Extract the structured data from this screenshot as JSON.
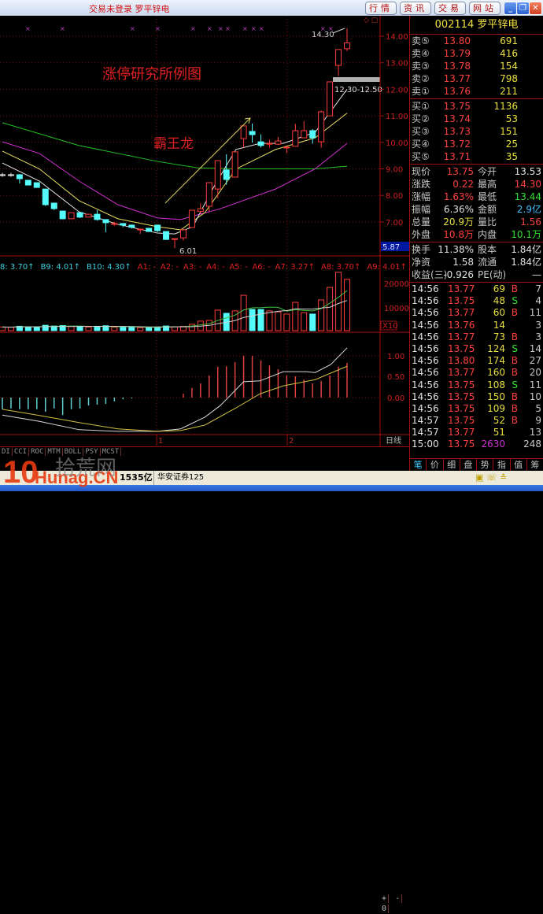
{
  "window": {
    "title": "交易未登录 罗平锌电",
    "nav_buttons": [
      "行情",
      "资讯",
      "交易",
      "网站"
    ],
    "window_buttons": [
      "minimize",
      "restore",
      "close"
    ]
  },
  "chart": {
    "annotation_title": "涨停研究所例图",
    "annotation_pattern": "霸王龙",
    "high_label": "14.30",
    "low_label": "6.01",
    "zone_label": "12.30-12.50",
    "zone": [
      12.3,
      12.5
    ],
    "price_ticks": [
      "14.00",
      "13.00",
      "12.00",
      "11.00",
      "10.00",
      "9.00",
      "8.00",
      "7.00"
    ],
    "cursor_price": "5.87",
    "colors": {
      "up": "#ff3c3c",
      "down": "#54fcfc",
      "ma5": "#e8e8e8",
      "ma10": "#e8e060",
      "ma30": "#d030d0",
      "ma60": "#20c020"
    },
    "kline": [
      [
        8.78,
        8.78,
        8.85,
        8.7
      ],
      [
        8.78,
        8.78,
        8.85,
        8.7
      ],
      [
        8.78,
        8.63,
        8.8,
        8.45
      ],
      [
        8.57,
        8.39,
        8.57,
        8.39
      ],
      [
        8.48,
        8.3,
        8.48,
        8.3
      ],
      [
        8.24,
        7.65,
        8.24,
        7.6
      ],
      [
        7.71,
        7.5,
        7.71,
        7.45
      ],
      [
        7.41,
        7.12,
        7.41,
        7.1
      ],
      [
        7.12,
        7.35,
        7.35,
        7.12
      ],
      [
        7.35,
        7.18,
        7.35,
        7.15
      ],
      [
        7.18,
        7.29,
        7.29,
        7.18
      ],
      [
        7.29,
        7.09,
        7.45,
        7.05
      ],
      [
        7.09,
        6.97,
        7.09,
        6.61
      ],
      [
        6.94,
        6.94,
        7.0,
        6.85
      ],
      [
        6.94,
        6.88,
        6.94,
        6.8
      ],
      [
        6.88,
        6.8,
        6.9,
        6.75
      ],
      [
        6.73,
        6.73,
        6.73,
        6.55
      ],
      [
        6.76,
        6.64,
        6.76,
        6.62
      ],
      [
        6.88,
        6.67,
        6.9,
        6.62
      ],
      [
        6.64,
        6.34,
        6.64,
        6.32
      ],
      [
        6.37,
        6.37,
        6.37,
        6.01
      ],
      [
        6.4,
        6.7,
        6.75,
        6.3
      ],
      [
        6.79,
        7.44,
        7.44,
        6.79
      ],
      [
        7.4,
        7.5,
        7.7,
        7.3
      ],
      [
        7.59,
        8.48,
        8.48,
        7.4
      ],
      [
        8.24,
        9.31,
        9.31,
        7.9
      ],
      [
        8.96,
        8.6,
        9.55,
        8.4
      ],
      [
        8.69,
        9.64,
        9.64,
        8.69
      ],
      [
        10.14,
        10.62,
        10.62,
        9.8
      ],
      [
        10.41,
        10.29,
        10.71,
        9.99
      ],
      [
        10.02,
        9.88,
        10.3,
        9.8
      ],
      [
        9.96,
        9.96,
        10.1,
        9.8
      ],
      [
        9.93,
        10.05,
        10.2,
        9.9
      ],
      [
        9.82,
        9.82,
        9.82,
        9.6
      ],
      [
        9.85,
        10.44,
        10.7,
        9.85
      ],
      [
        10.17,
        10.44,
        10.8,
        10.17
      ],
      [
        10.44,
        10.17,
        10.5,
        9.95
      ],
      [
        10.02,
        11.15,
        11.2,
        9.8
      ],
      [
        11.0,
        12.28,
        12.28,
        11.0
      ],
      [
        12.9,
        13.5,
        13.5,
        12.5
      ],
      [
        13.53,
        13.75,
        14.3,
        13.44
      ]
    ],
    "ma_lines": {
      "ma60": [
        [
          0,
          10.74
        ],
        [
          8.9,
          9.88
        ],
        [
          18,
          9.28
        ],
        [
          22.6,
          9.04
        ],
        [
          27.1,
          9.0
        ],
        [
          36.3,
          9.0
        ],
        [
          40,
          9.1
        ]
      ],
      "ma30": [
        [
          0,
          10.02
        ],
        [
          4.3,
          9.58
        ],
        [
          8.9,
          8.54
        ],
        [
          13.4,
          7.65
        ],
        [
          18,
          7.15
        ],
        [
          20.7,
          7.09
        ],
        [
          25.3,
          7.5
        ],
        [
          31.7,
          8.24
        ],
        [
          36.3,
          9.0
        ],
        [
          40,
          9.96
        ]
      ],
      "ma10": [
        [
          0,
          9.67
        ],
        [
          4.3,
          9.0
        ],
        [
          8.9,
          7.8
        ],
        [
          13.4,
          7.12
        ],
        [
          18,
          6.82
        ],
        [
          20.7,
          6.7
        ],
        [
          23.5,
          7.35
        ],
        [
          27.1,
          8.99
        ],
        [
          31.7,
          9.73
        ],
        [
          36.3,
          10.17
        ],
        [
          40,
          11.1
        ]
      ],
      "ma5": [
        [
          0,
          9.22
        ],
        [
          4.3,
          8.54
        ],
        [
          8.9,
          7.38
        ],
        [
          13.4,
          6.91
        ],
        [
          18,
          6.58
        ],
        [
          20,
          6.55
        ],
        [
          22.1,
          6.82
        ],
        [
          24.4,
          8.24
        ],
        [
          27.1,
          9.73
        ],
        [
          29.9,
          9.96
        ],
        [
          32.6,
          9.96
        ],
        [
          36.3,
          10.38
        ],
        [
          40,
          12.0
        ]
      ]
    },
    "volume_legend_cyan": [
      "8: 3.70↑",
      "B9: 4.01↑",
      "B10: 4.30↑"
    ],
    "volume_legend_red": [
      "A1: -",
      "A2: -",
      "A3: -",
      "A4: -",
      "A5: -",
      "A6: -",
      "A7: 3.27↑",
      "A8: 3.70↑",
      "A9: 4.01↑",
      "A"
    ],
    "volume_ticks": [
      "20000",
      "10000"
    ],
    "volume_unit": "X10",
    "volume": [
      1500,
      1400,
      1800,
      1600,
      1500,
      2200,
      1900,
      2100,
      1700,
      1600,
      1500,
      1800,
      2000,
      1400,
      1300,
      1500,
      1200,
      1400,
      1500,
      1900,
      1600,
      1800,
      2600,
      3900,
      4200,
      8400,
      7100,
      8100,
      14500,
      8700,
      8700,
      8100,
      7700,
      6800,
      11600,
      7400,
      6800,
      12600,
      17700,
      23900,
      21000
    ],
    "macd_ticks": [
      "1.00",
      "0.50",
      "0.00"
    ],
    "macd": [
      -0.28,
      -0.26,
      -0.28,
      -0.28,
      -0.28,
      -0.34,
      -0.26,
      -0.42,
      -0.28,
      -0.26,
      -0.19,
      -0.17,
      -0.15,
      -0.09,
      -0.04,
      -0.02,
      0,
      0,
      0,
      0,
      0,
      0.09,
      0.23,
      0.34,
      0.53,
      0.74,
      0.75,
      0.85,
      1.0,
      1.0,
      0.89,
      0.77,
      0.68,
      0.53,
      0.51,
      0.43,
      0.34,
      0.4,
      0.53,
      0.74,
      0.83
    ],
    "dif": [
      [
        0,
        -0.42
      ],
      [
        4.3,
        -0.57
      ],
      [
        8.9,
        -0.77
      ],
      [
        13.4,
        -0.81
      ],
      [
        18,
        -0.81
      ],
      [
        20.7,
        -0.75
      ],
      [
        23.5,
        -0.47
      ],
      [
        25.3,
        -0.19
      ],
      [
        28,
        0.38
      ],
      [
        29.9,
        0.4
      ],
      [
        32.6,
        0.62
      ],
      [
        35.3,
        0.62
      ],
      [
        36.3,
        0.6
      ],
      [
        38.1,
        0.79
      ],
      [
        40,
        1.19
      ]
    ],
    "dea": [
      [
        0,
        -0.28
      ],
      [
        4.3,
        -0.43
      ],
      [
        8.9,
        -0.6
      ],
      [
        13.4,
        -0.75
      ],
      [
        18,
        -0.81
      ],
      [
        20.7,
        -0.79
      ],
      [
        23.5,
        -0.66
      ],
      [
        27.1,
        -0.25
      ],
      [
        29.9,
        0.09
      ],
      [
        32.6,
        0.28
      ],
      [
        36.3,
        0.43
      ],
      [
        40,
        0.75
      ]
    ],
    "date_labels": [
      "1",
      "2"
    ],
    "period": "日线",
    "indicator_tabs": [
      "DI",
      "CCI",
      "ROC",
      "MTM",
      "BOLL",
      "PSY",
      "MCST"
    ],
    "zoom_buttons": [
      "+",
      "-",
      "0"
    ]
  },
  "quote": {
    "code": "002114",
    "name": "罗平锌电",
    "asks": [
      {
        "label": "卖⑤",
        "price": "13.80",
        "vol": "691"
      },
      {
        "label": "卖④",
        "price": "13.79",
        "vol": "416"
      },
      {
        "label": "卖③",
        "price": "13.78",
        "vol": "154"
      },
      {
        "label": "卖②",
        "price": "13.77",
        "vol": "798"
      },
      {
        "label": "卖①",
        "price": "13.76",
        "vol": "211"
      }
    ],
    "bids": [
      {
        "label": "买①",
        "price": "13.75",
        "vol": "1136"
      },
      {
        "label": "买②",
        "price": "13.74",
        "vol": "53"
      },
      {
        "label": "买③",
        "price": "13.73",
        "vol": "151"
      },
      {
        "label": "买④",
        "price": "13.72",
        "vol": "25"
      },
      {
        "label": "买⑤",
        "price": "13.71",
        "vol": "35"
      }
    ],
    "stats": [
      {
        "l1": "现价",
        "v1": "13.75",
        "c1": "red",
        "l2": "今开",
        "v2": "13.53",
        "c2": "wht"
      },
      {
        "l1": "涨跌",
        "v1": "0.22",
        "c1": "red",
        "l2": "最高",
        "v2": "14.30",
        "c2": "red"
      },
      {
        "l1": "涨幅",
        "v1": "1.63%",
        "c1": "red",
        "l2": "最低",
        "v2": "13.44",
        "c2": "grn"
      },
      {
        "l1": "振幅",
        "v1": "6.36%",
        "c1": "wht",
        "l2": "金额",
        "v2": "2.9亿",
        "c2": "cyn"
      },
      {
        "l1": "总量",
        "v1": "20.9万",
        "c1": "yel",
        "l2": "量比",
        "v2": "1.56",
        "c2": "red"
      },
      {
        "l1": "外盘",
        "v1": "10.8万",
        "c1": "red",
        "l2": "内盘",
        "v2": "10.1万",
        "c2": "grn"
      }
    ],
    "stats2": [
      {
        "l1": "换手",
        "v1": "11.38%",
        "c1": "wht",
        "l2": "股本",
        "v2": "1.84亿",
        "c2": "wht"
      },
      {
        "l1": "净资",
        "v1": "1.58",
        "c1": "wht",
        "l2": "流通",
        "v2": "1.84亿",
        "c2": "wht"
      },
      {
        "l1": "收益(三)",
        "v1": "-0.926",
        "c1": "wht",
        "l2": "PE(动)",
        "v2": "—",
        "c2": "wht"
      }
    ],
    "ticks": [
      {
        "t": "14:56",
        "p": "13.77",
        "v": "69",
        "bs": "B",
        "n": "7"
      },
      {
        "t": "14:56",
        "p": "13.75",
        "v": "48",
        "bs": "S",
        "n": "4"
      },
      {
        "t": "14:56",
        "p": "13.77",
        "v": "60",
        "bs": "B",
        "n": "11"
      },
      {
        "t": "14:56",
        "p": "13.76",
        "v": "14",
        "bs": "",
        "n": "3"
      },
      {
        "t": "14:56",
        "p": "13.77",
        "v": "73",
        "bs": "B",
        "n": "3"
      },
      {
        "t": "14:56",
        "p": "13.75",
        "v": "124",
        "bs": "S",
        "n": "14"
      },
      {
        "t": "14:56",
        "p": "13.80",
        "v": "174",
        "bs": "B",
        "n": "27"
      },
      {
        "t": "14:56",
        "p": "13.77",
        "v": "160",
        "bs": "B",
        "n": "20"
      },
      {
        "t": "14:56",
        "p": "13.75",
        "v": "108",
        "bs": "S",
        "n": "11"
      },
      {
        "t": "14:56",
        "p": "13.75",
        "v": "150",
        "bs": "B",
        "n": "10"
      },
      {
        "t": "14:56",
        "p": "13.75",
        "v": "109",
        "bs": "B",
        "n": "5"
      },
      {
        "t": "14:57",
        "p": "13.75",
        "v": "52",
        "bs": "B",
        "n": "9"
      },
      {
        "t": "14:57",
        "p": "13.77",
        "v": "51",
        "bs": "",
        "n": "13"
      },
      {
        "t": "15:00",
        "p": "13.75",
        "v": "2630",
        "bs": "",
        "n": "248"
      }
    ],
    "tabs": [
      "笔",
      "价",
      "细",
      "盘",
      "势",
      "指",
      "值",
      "筹"
    ]
  },
  "status": {
    "turnover": "1535亿",
    "broker": "华安证券125"
  },
  "watermark": {
    "logo": "10",
    "site": "Hunag.CN",
    "cn": "拾荒网"
  }
}
